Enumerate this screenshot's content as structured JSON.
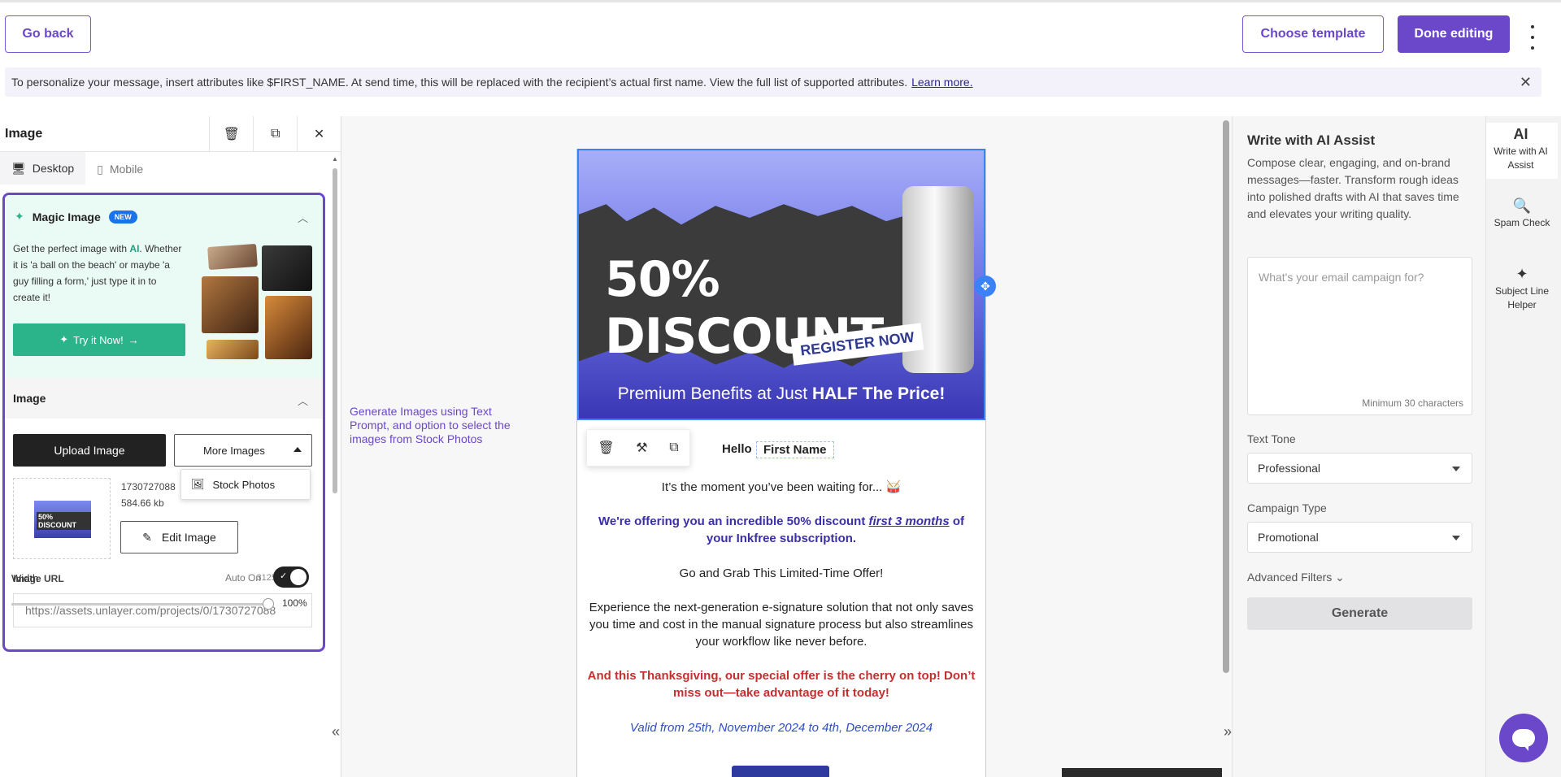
{
  "header": {
    "go_back": "Go back",
    "choose_template": "Choose template",
    "done_editing": "Done editing"
  },
  "info_banner": {
    "text": "To personalize your message, insert attributes like $FIRST_NAME. At send time, this will be replaced with the recipient’s actual first name. View the full list of supported attributes.",
    "link": "Learn more."
  },
  "left_panel": {
    "title": "Image",
    "tabs": [
      "Desktop",
      "Mobile"
    ],
    "magic": {
      "title": "Magic Image",
      "badge": "NEW",
      "text_before": "Get the perfect image with ",
      "text_ai": "AI",
      "text_after": ". Whether it is 'a ball on the beach' or maybe 'a guy filling a form,' just type it in to create it!",
      "try_label": "Try it Now!"
    },
    "image_section": {
      "title": "Image",
      "upload_label": "Upload Image",
      "more_label": "More Images",
      "dropdown_item": "Stock Photos",
      "file_name": "1730727088",
      "file_size": "584.66 kb",
      "thumb_text": "50% DISCOUNT",
      "edit_label": "Edit Image",
      "url_label": "Image URL",
      "dimensions": "3125 × 2084",
      "url_value": "https://assets.unlayer.com/projects/0/1730727088"
    },
    "width": {
      "label": "Width",
      "auto_label": "Auto On",
      "value": "100%"
    }
  },
  "canvas": {
    "hint": "Generate Images using Text Prompt, and option to select the images from Stock Photos",
    "banner": {
      "headline": "50% DISCOUNT",
      "register": "REGISTER NOW",
      "bottom_before": "Premium Benefits at Just ",
      "bottom_bold": "HALF The Price!"
    },
    "email": {
      "hello": "Hello",
      "first_name_tag": "First Name",
      "line1": "It’s the moment you’ve been waiting for... 🥁",
      "offer_before": "We're offering you an incredible 50% discount ",
      "offer_link": "first 3 months",
      "offer_after": " of your Inkfree subscription.",
      "line3": "Go and Grab This Limited-Time Offer!",
      "line4": "Experience the next-generation e-signature solution that not only saves you time and cost in the manual signature process but also streamlines your workflow like never before.",
      "line5": "And this Thanksgiving, our special offer is the cherry on top! Don’t miss out—take advantage of it today!",
      "line6": "Valid from 25th, November 2024 to 4th, December 2024"
    }
  },
  "ai_panel": {
    "title": "Write with AI Assist",
    "description": "Compose clear, engaging, and on-brand messages—faster. Transform rough ideas into polished drafts with AI that saves time and elevates your writing quality.",
    "placeholder": "What's your email campaign for?",
    "min_chars": "Minimum 30 characters",
    "tone_label": "Text Tone",
    "tone_value": "Professional",
    "campaign_label": "Campaign Type",
    "campaign_value": "Promotional",
    "advanced": "Advanced Filters",
    "generate": "Generate"
  },
  "rail": [
    {
      "icon": "AI",
      "label": "Write with AI Assist"
    },
    {
      "icon": "🔍",
      "label": "Spam Check"
    },
    {
      "icon": "✦",
      "label": "Subject Line Helper"
    }
  ]
}
